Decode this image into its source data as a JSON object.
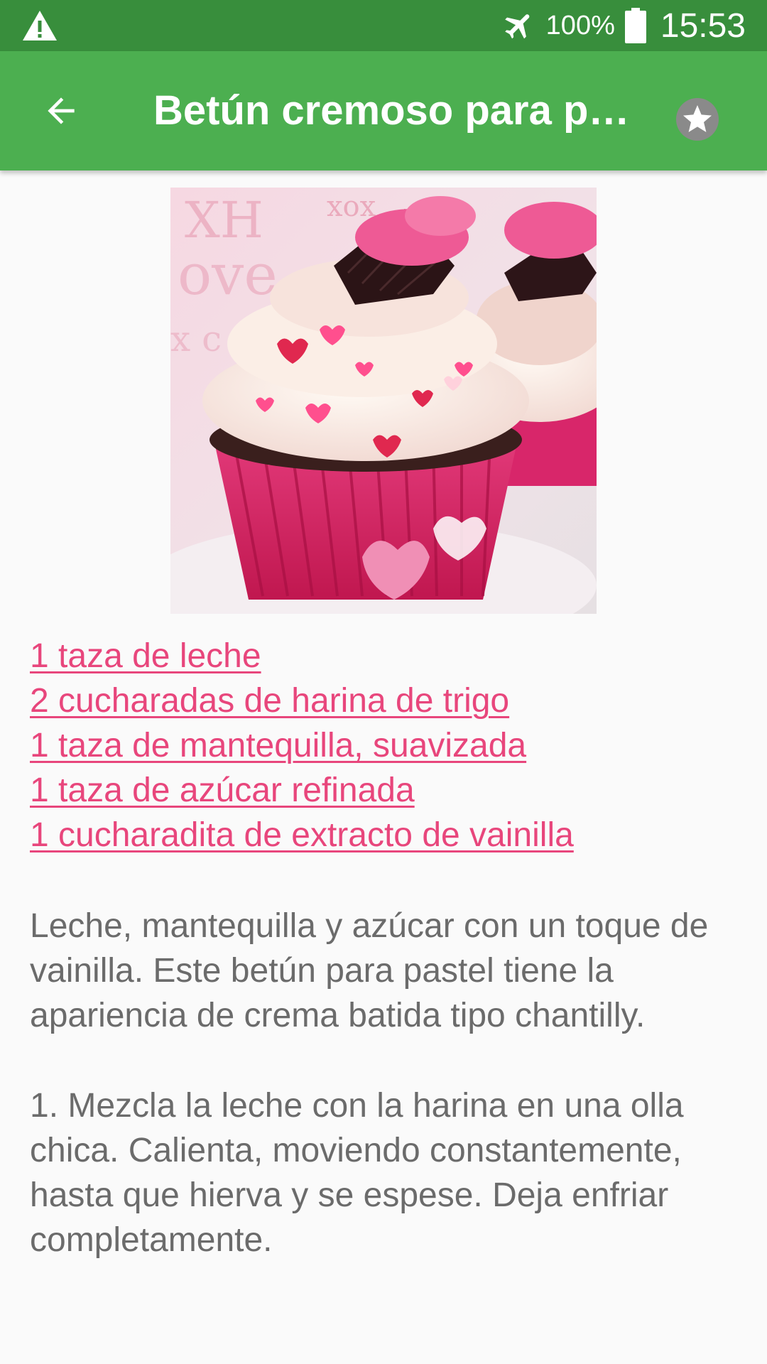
{
  "status_bar": {
    "battery_percent": "100%",
    "time": "15:53",
    "icons": [
      "warning-icon",
      "airplane-mode-icon",
      "battery-icon"
    ]
  },
  "app_bar": {
    "title": "Betún cremoso para pastel",
    "back_icon": "arrow-back-icon",
    "favorite_icon": "star-icon"
  },
  "recipe": {
    "image": "cupcakes-with-pink-frosting-photo",
    "ingredients": [
      "1 taza de leche",
      "2 cucharadas de harina de trigo",
      "1 taza de mantequilla, suavizada",
      "1 taza de azúcar refinada",
      "1 cucharadita de extracto de vainilla"
    ],
    "description": "Leche, mantequilla y azúcar con un toque de vainilla. Este betún para pastel tiene la apariencia de crema batida tipo chantilly.",
    "steps": [
      "1. Mezcla la leche con la harina en una olla chica. Calienta, moviendo constantemente, hasta que hierva y se espese. Deja enfriar completamente."
    ]
  },
  "colors": {
    "status_bar": "#388e3c",
    "app_bar": "#4caf50",
    "link": "#e8467c",
    "body_text": "#6b6b6b",
    "background": "#fafafa"
  }
}
